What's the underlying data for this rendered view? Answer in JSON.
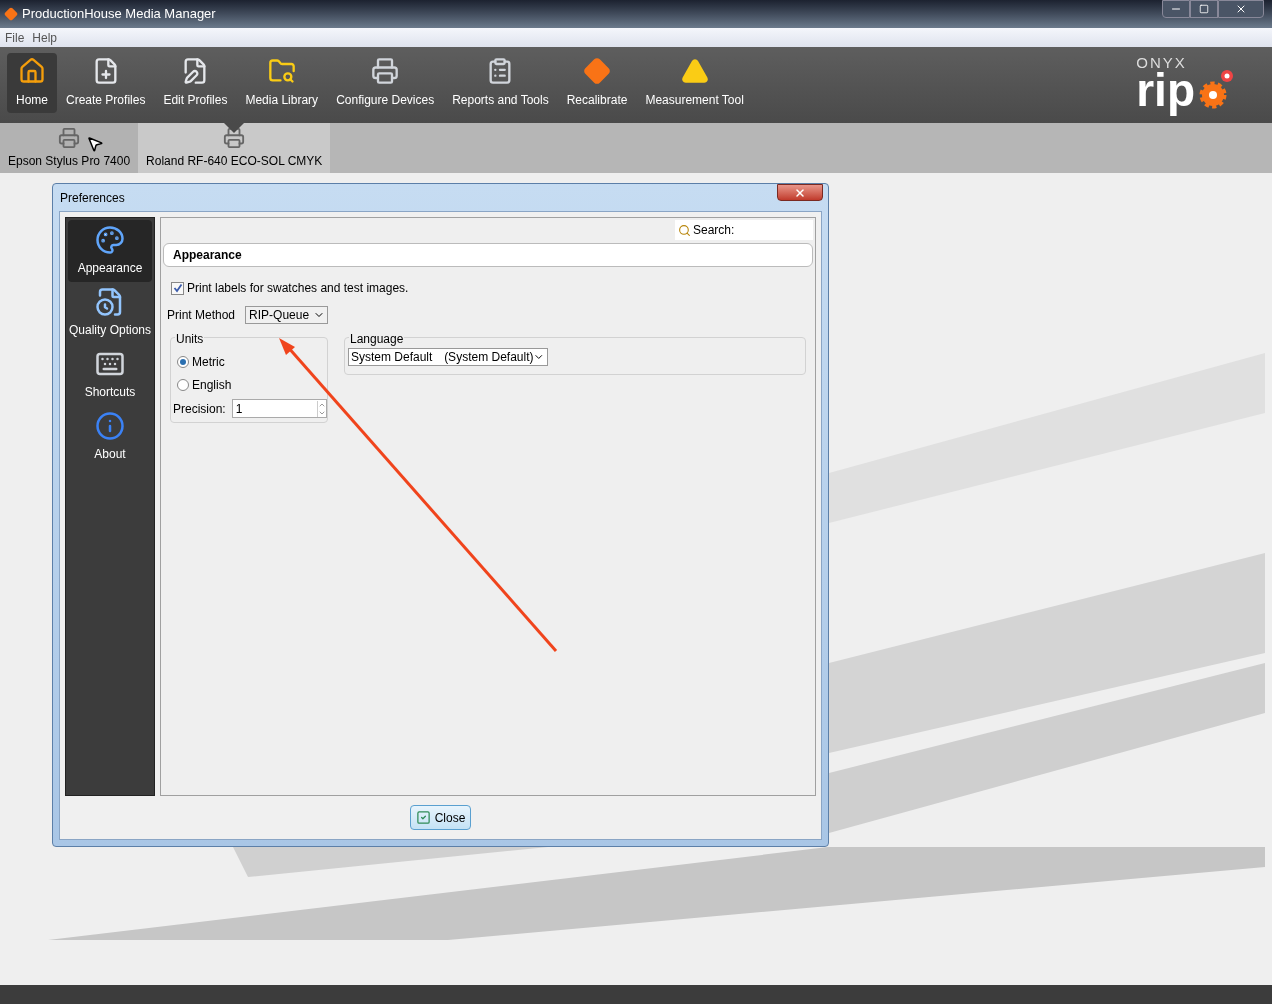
{
  "window": {
    "title": "ProductionHouse Media Manager"
  },
  "menu": [
    {
      "label": "File"
    },
    {
      "label": "Help"
    }
  ],
  "toolbar": [
    {
      "label": "Home",
      "selected": true
    },
    {
      "label": "Create Profiles",
      "selected": false
    },
    {
      "label": "Edit Profiles",
      "selected": false
    },
    {
      "label": "Media Library",
      "selected": false
    },
    {
      "label": "Configure Devices",
      "selected": false
    },
    {
      "label": "Reports and Tools",
      "selected": false
    },
    {
      "label": "Recalibrate",
      "selected": false
    },
    {
      "label": "Measurement Tool",
      "selected": false
    }
  ],
  "logo": {
    "brand": "ONYX",
    "product": "rip"
  },
  "devices": [
    {
      "label": "Epson Stylus Pro 7400",
      "selected": false
    },
    {
      "label": "Roland RF-640 ECO-SOL CMYK",
      "selected": true
    }
  ],
  "dialog": {
    "title": "Preferences",
    "nav": [
      {
        "label": "Appearance",
        "selected": true
      },
      {
        "label": "Quality Options",
        "selected": false
      },
      {
        "label": "Shortcuts",
        "selected": false
      },
      {
        "label": "About",
        "selected": false
      }
    ],
    "search": {
      "label": "Search:"
    },
    "section": "Appearance",
    "print_labels": {
      "label": "Print labels for swatches and test images.",
      "checked": true
    },
    "print_method": {
      "label": "Print Method",
      "value": "RIP-Queue"
    },
    "units": {
      "title": "Units",
      "options": [
        {
          "label": "Metric",
          "selected": true
        },
        {
          "label": "English",
          "selected": false
        }
      ],
      "precision": {
        "label": "Precision:",
        "value": "1"
      }
    },
    "language": {
      "title": "Language",
      "value": "System Default",
      "detail": "(System Default)"
    },
    "close_button": "Close"
  }
}
